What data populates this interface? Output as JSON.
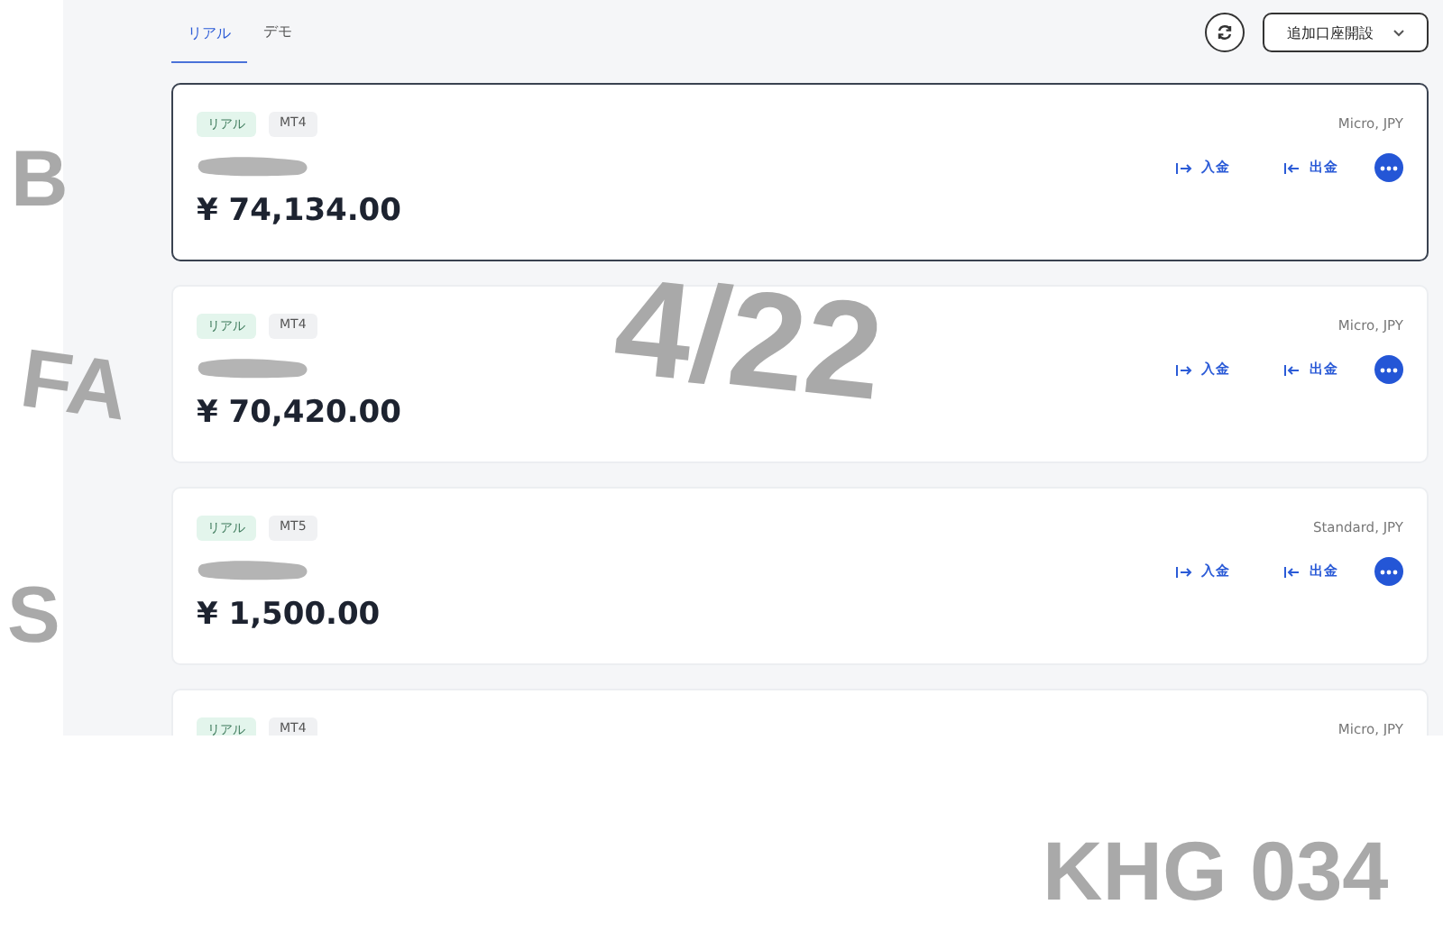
{
  "tabs": [
    {
      "label": "リアル",
      "selected": true
    },
    {
      "label": "デモ",
      "selected": false
    }
  ],
  "header": {
    "open_account_button": "追加口座開設"
  },
  "accounts": [
    {
      "selected": true,
      "tags": [
        {
          "kind": "type",
          "label": "リアル"
        },
        {
          "kind": "platform",
          "label": "MT4"
        }
      ],
      "plan": "Micro, JPY",
      "balance": "¥ 74,134.00",
      "deposit": "入金",
      "withdraw": "出金"
    },
    {
      "selected": false,
      "tags": [
        {
          "kind": "type",
          "label": "リアル"
        },
        {
          "kind": "platform",
          "label": "MT4"
        }
      ],
      "plan": "Micro, JPY",
      "balance": "¥ 70,420.00",
      "deposit": "入金",
      "withdraw": "出金"
    },
    {
      "selected": false,
      "tags": [
        {
          "kind": "type",
          "label": "リアル"
        },
        {
          "kind": "platform",
          "label": "MT5"
        }
      ],
      "plan": "Standard, JPY",
      "balance": "¥ 1,500.00",
      "deposit": "入金",
      "withdraw": "出金"
    },
    {
      "selected": false,
      "tags": [
        {
          "kind": "type",
          "label": "リアル"
        },
        {
          "kind": "platform",
          "label": "MT4"
        }
      ],
      "plan": "Micro, JPY"
    }
  ],
  "annotations": [
    {
      "kind": "side",
      "text": "B"
    },
    {
      "kind": "side",
      "text": "FA"
    },
    {
      "kind": "side",
      "text": "S"
    },
    {
      "kind": "date",
      "text": "4/22"
    },
    {
      "kind": "code",
      "text": "KHG 034"
    }
  ]
}
